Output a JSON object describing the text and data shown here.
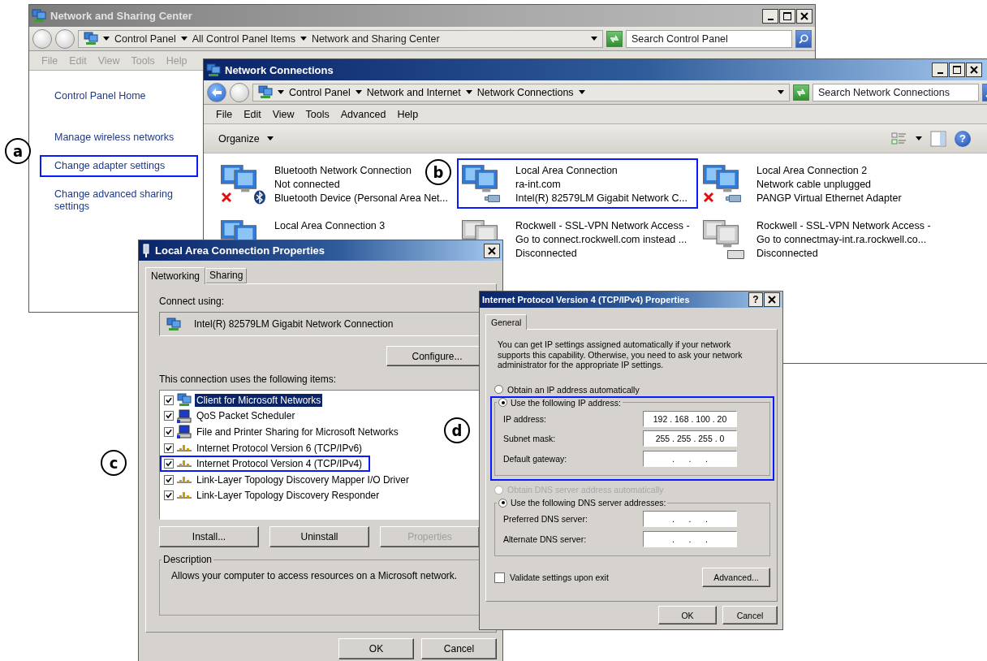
{
  "callouts": [
    {
      "label": "a"
    },
    {
      "label": "b"
    },
    {
      "label": "c"
    },
    {
      "label": "d"
    }
  ],
  "sharing_center": {
    "title": "Network and Sharing Center",
    "active": false,
    "back_enabled": false,
    "breadcrumb": [
      "Control Panel",
      "All Control Panel Items",
      "Network and Sharing Center"
    ],
    "search": {
      "placeholder": "Search Control Panel"
    },
    "menu": [
      "File",
      "Edit",
      "View",
      "Tools",
      "Help"
    ],
    "links": [
      {
        "label": "Control Panel Home",
        "highlighted": false
      },
      {
        "label": "Manage wireless networks",
        "highlighted": false
      },
      {
        "label": "Change adapter settings",
        "highlighted": true
      },
      {
        "label": "Change advanced sharing settings",
        "highlighted": false
      }
    ]
  },
  "network_connections": {
    "title": "Network Connections",
    "active": true,
    "back_enabled": true,
    "breadcrumb": [
      "Control Panel",
      "Network and Internet",
      "Network Connections"
    ],
    "search": {
      "placeholder": "Search Network Connections"
    },
    "menu": [
      "File",
      "Edit",
      "View",
      "Tools",
      "Advanced",
      "Help"
    ],
    "organize": "Organize",
    "help": "?",
    "connections": [
      {
        "name": "Bluetooth Network Connection",
        "lines": [
          "Not connected",
          "Bluetooth Device (Personal Area Net..."
        ],
        "kind": "bluetooth",
        "error": true,
        "highlighted": false
      },
      {
        "name": "Local Area Connection",
        "lines": [
          "ra-int.com",
          "Intel(R) 82579LM Gigabit Network C..."
        ],
        "kind": "ethernet",
        "error": false,
        "highlighted": true
      },
      {
        "name": "Local Area Connection 2",
        "lines": [
          "Network cable unplugged",
          "PANGP Virtual Ethernet Adapter"
        ],
        "kind": "ethernet",
        "error": true,
        "highlighted": false
      },
      {
        "name": "Local Area Connection 3",
        "kind": "ethernet",
        "error": false,
        "highlighted": false
      },
      {
        "name": "Rockwell - SSL-VPN Network Access -",
        "lines": [
          "Go to connect.rockwell.com instead ...",
          "Disconnected"
        ],
        "kind": "vpn",
        "error": false,
        "highlighted": false
      },
      {
        "name": "Rockwell - SSL-VPN Network Access -",
        "lines": [
          "Go to connectmay-int.ra.rockwell.co...",
          "Disconnected"
        ],
        "kind": "vpn",
        "error": false,
        "highlighted": false
      }
    ]
  },
  "lan_properties": {
    "title": "Local Area Connection Properties",
    "active": true,
    "tabs": [
      {
        "label": "Networking",
        "selected": true
      },
      {
        "label": "Sharing",
        "selected": false
      }
    ],
    "connect_using": "Connect using:",
    "adapter": "Intel(R) 82579LM Gigabit Network Connection",
    "configure": "Configure...",
    "items_label": "This connection uses the following items:",
    "items": [
      {
        "label": "Client for Microsoft Networks",
        "kind": "client",
        "checked": true,
        "selected": true,
        "highlighted": false
      },
      {
        "label": "QoS Packet Scheduler",
        "kind": "service",
        "checked": true,
        "selected": false,
        "highlighted": false
      },
      {
        "label": "File and Printer Sharing for Microsoft Networks",
        "kind": "service",
        "checked": true,
        "selected": false,
        "highlighted": false
      },
      {
        "label": "Internet Protocol Version 6 (TCP/IPv6)",
        "kind": "protocol",
        "checked": true,
        "selected": false,
        "highlighted": false
      },
      {
        "label": "Internet Protocol Version 4 (TCP/IPv4)",
        "kind": "protocol",
        "checked": true,
        "selected": false,
        "highlighted": true
      },
      {
        "label": "Link-Layer Topology Discovery Mapper I/O Driver",
        "kind": "protocol",
        "checked": true,
        "selected": false,
        "highlighted": false
      },
      {
        "label": "Link-Layer Topology Discovery Responder",
        "kind": "protocol",
        "checked": true,
        "selected": false,
        "highlighted": false
      }
    ],
    "buttons": [
      {
        "label": "Install...",
        "disabled": false
      },
      {
        "label": "Uninstall",
        "disabled": false
      },
      {
        "label": "Properties",
        "disabled": true
      }
    ],
    "description_label": "Description",
    "description": "Allows your computer to access resources on a Microsoft network.",
    "ok": "OK",
    "cancel": "Cancel"
  },
  "ipv4_properties": {
    "title": "Internet Protocol Version 4 (TCP/IPv4) Properties",
    "active": true,
    "help": "?",
    "tabs": [
      {
        "label": "General",
        "selected": true
      }
    ],
    "intro": "You can get IP settings assigned automatically if your network supports this capability. Otherwise, you need to ask your network administrator for the appropriate IP settings.",
    "ip_options": [
      {
        "label": "Obtain an IP address automatically",
        "selected": false,
        "disabled": false
      },
      {
        "label": "Use the following IP address:",
        "selected": true,
        "disabled": false
      }
    ],
    "ip_highlighted": true,
    "ip_fields": [
      {
        "label": "IP address:",
        "value": "192 . 168 . 100 . 20"
      },
      {
        "label": "Subnet mask:",
        "value": "255 . 255 . 255 . 0"
      },
      {
        "label": "Default gateway:",
        "value": ".      .      ."
      }
    ],
    "dns_options": [
      {
        "label": "Obtain DNS server address automatically",
        "selected": false,
        "disabled": true
      },
      {
        "label": "Use the following DNS server addresses:",
        "selected": true,
        "disabled": false
      }
    ],
    "dns_fields": [
      {
        "label": "Preferred DNS server:",
        "value": ".      .      ."
      },
      {
        "label": "Alternate DNS server:",
        "value": ".      .      ."
      }
    ],
    "validate": {
      "label": "Validate settings upon exit",
      "checked": false
    },
    "advanced": "Advanced...",
    "ok": "OK",
    "cancel": "Cancel"
  }
}
